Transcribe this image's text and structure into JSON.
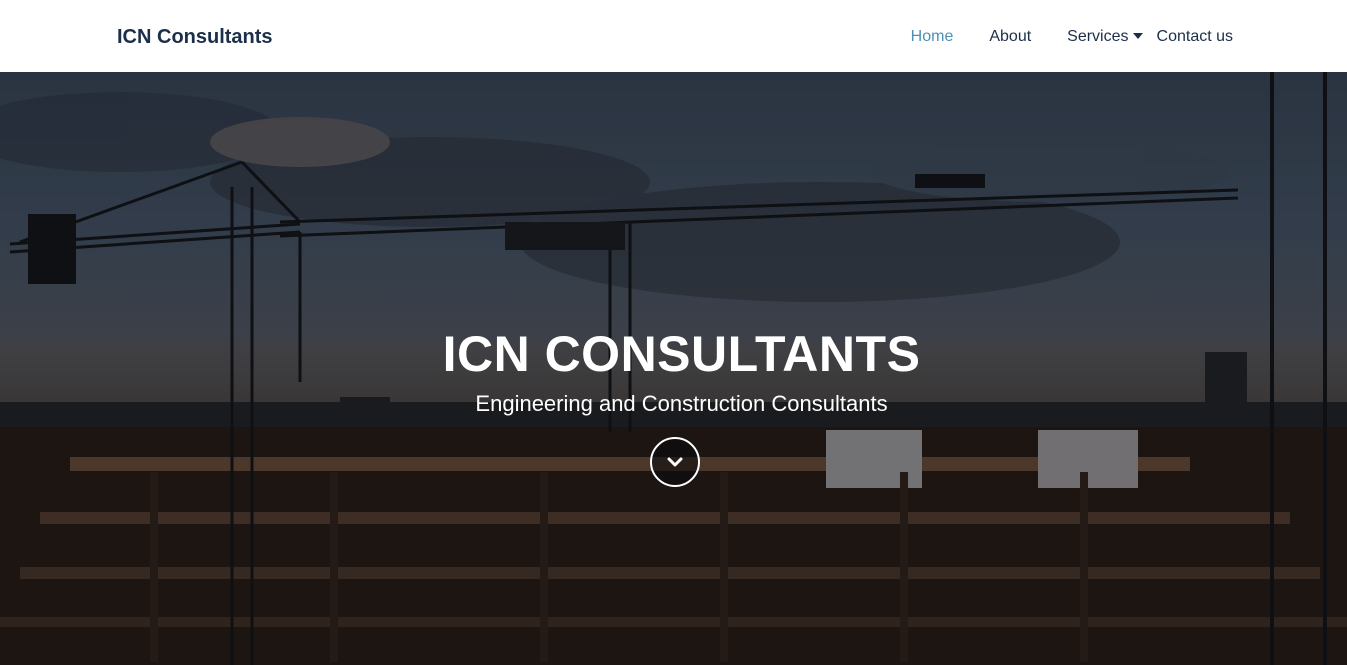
{
  "navbar": {
    "brand": "ICN Consultants",
    "links": [
      {
        "label": "Home",
        "active": true
      },
      {
        "label": "About",
        "active": false
      },
      {
        "label": "Services",
        "active": false,
        "dropdown": true
      },
      {
        "label": "Contact us",
        "active": false
      }
    ]
  },
  "hero": {
    "title": "ICN CONSULTANTS",
    "subtitle": "Engineering and Construction Consultants",
    "scroll_icon": "chevron-down-icon"
  },
  "colors": {
    "brand": "#1c2f4a",
    "active_link": "#4f8fb5",
    "hero_text": "#ffffff"
  }
}
